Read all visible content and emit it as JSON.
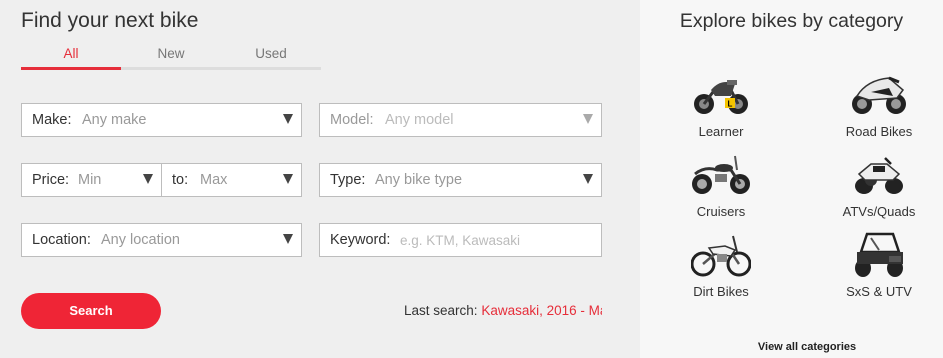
{
  "search": {
    "title": "Find your next bike",
    "tabs": [
      {
        "label": "All",
        "active": true
      },
      {
        "label": "New",
        "active": false
      },
      {
        "label": "Used",
        "active": false
      }
    ],
    "make": {
      "label": "Make:",
      "value": "Any make"
    },
    "model": {
      "label": "Model:",
      "value": "Any model"
    },
    "price_min": {
      "label": "Price:",
      "value": "Min"
    },
    "price_max": {
      "label": "to:",
      "value": "Max"
    },
    "type": {
      "label": "Type:",
      "value": "Any bike type"
    },
    "location": {
      "label": "Location:",
      "value": "Any location"
    },
    "keyword": {
      "label": "Keyword:",
      "placeholder": "e.g. KTM, Kawasaki"
    },
    "button_label": "Search",
    "last_search_label": "Last search:",
    "last_search_value": "Kawasaki, 2016 - Ma"
  },
  "categories": {
    "title": "Explore bikes by category",
    "items": [
      {
        "label": "Learner",
        "icon": "learner-bike-icon"
      },
      {
        "label": "Road Bikes",
        "icon": "road-bike-icon"
      },
      {
        "label": "Cruisers",
        "icon": "cruiser-bike-icon"
      },
      {
        "label": "ATVs/Quads",
        "icon": "atv-quad-icon"
      },
      {
        "label": "Dirt Bikes",
        "icon": "dirt-bike-icon"
      },
      {
        "label": "SxS & UTV",
        "icon": "sxs-utv-icon"
      }
    ],
    "view_all": "View all categories"
  },
  "colors": {
    "accent": "#e62e3a",
    "button": "#ef2536"
  }
}
